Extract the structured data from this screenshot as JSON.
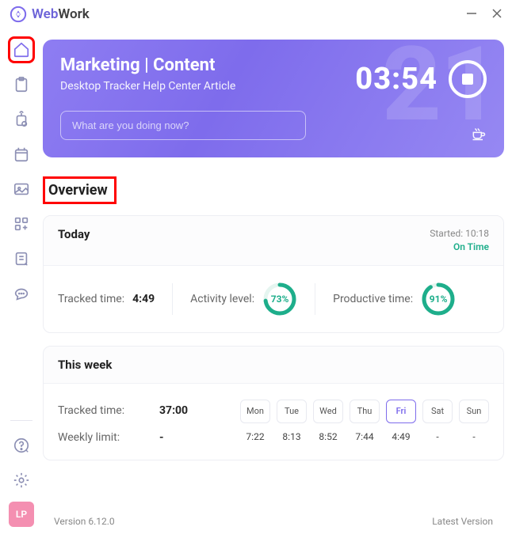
{
  "brand": {
    "name": "WebWork",
    "logo_color": "#7e6cec"
  },
  "header": {
    "project_line1": "Marketing | Content",
    "project_line2": "Desktop Tracker Help Center Article",
    "background_number": "21",
    "timer": "03:54",
    "input_placeholder": "What are you doing now?"
  },
  "overview_label": "Overview",
  "today": {
    "title": "Today",
    "started_label": "Started: 10:18",
    "status": "On Time",
    "tracked_label": "Tracked time:",
    "tracked_value": "4:49",
    "activity_label": "Activity level:",
    "activity_pct": "73%",
    "productive_label": "Productive time:",
    "productive_pct": "91%"
  },
  "week": {
    "title": "This week",
    "tracked_label": "Tracked time:",
    "tracked_value": "37:00",
    "limit_label": "Weekly limit:",
    "limit_value": "-",
    "days": [
      "Mon",
      "Tue",
      "Wed",
      "Thu",
      "Fri",
      "Sat",
      "Sun"
    ],
    "values": [
      "7:22",
      "8:13",
      "8:52",
      "7:44",
      "4:49",
      "-",
      "-"
    ],
    "active_index": 4
  },
  "avatar": {
    "initials": "LP"
  },
  "footer": {
    "version": "Version 6.12.0",
    "latest": "Latest Version"
  }
}
